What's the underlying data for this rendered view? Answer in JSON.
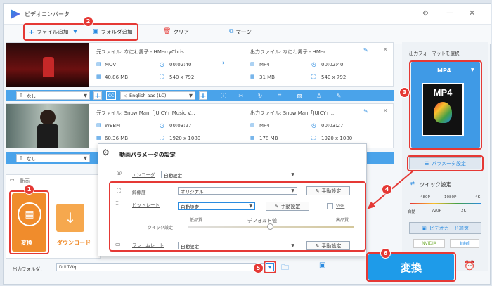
{
  "app": {
    "title": "ビデオコンバータ"
  },
  "toolbar": {
    "add_file": "ファイル追加",
    "add_folder": "フォルダ追加",
    "clear": "クリア",
    "merge": "マージ"
  },
  "files": [
    {
      "source": "元ファイル: なにわ男子 - HMerryChris...",
      "output": "出力ファイル: なにわ男子 - HMer...",
      "src_format": "MOV",
      "src_duration": "00:02:40",
      "src_size": "40.86 MB",
      "src_res": "540 x 792",
      "out_format": "MP4",
      "out_duration": "00:02:40",
      "out_size": "31 MB",
      "out_res": "540 x 792",
      "subtitle": "なし",
      "audio": "English aac (LC)"
    },
    {
      "source": "元ファイル: Snow Man「JUICY」Music V...",
      "output": "出力ファイル: Snow Man「JUICY」...",
      "src_format": "WEBM",
      "src_duration": "00:03:27",
      "src_size": "60.36 MB",
      "src_res": "1920 x 1080",
      "out_format": "MP4",
      "out_duration": "00:03:27",
      "out_size": "178 MB",
      "out_res": "1920 x 1080",
      "subtitle": "なし"
    }
  ],
  "left_panel": {
    "header": "動画",
    "convert": "変換",
    "download": "ダウンロード"
  },
  "dialog": {
    "title": "動画パラメータの設定",
    "encoder_label": "エンコーダ",
    "encoder_value": "自動設定",
    "resolution_label": "解像度",
    "resolution_value": "オリジナル",
    "bitrate_label": "ビットレート",
    "bitrate_value": "自動設定",
    "vbr": "VBR",
    "quick_label": "クイック設定",
    "low_q": "低品質",
    "default": "デフォルト値",
    "high_q": "高品質",
    "framerate_label": "フレームレート",
    "framerate_value": "自動設定",
    "manual": "手動設定"
  },
  "right_panel": {
    "header": "出力フォーマットを選択",
    "format": "MP4",
    "format_icon": "MP4",
    "param_button": "パラメータ設定",
    "quick_settings": "クイック設定",
    "q_top": [
      "480P",
      "1080P",
      "4K"
    ],
    "q_bottom": [
      "自動",
      "720P",
      "2K"
    ],
    "gpu_accel": "ビデオカード加速",
    "nvidia": "NVIDIA",
    "intel": "Intel"
  },
  "bottom": {
    "folder_label": "出力フォルダ：",
    "folder_path": "D:¥ffWq",
    "convert": "変換"
  },
  "badges": [
    "1",
    "2",
    "3",
    "4",
    "5",
    "6"
  ],
  "colors": {
    "accent": "#2a8be0",
    "highlight": "#e53935",
    "convert_btn": "#1e9be9",
    "orange": "#f08c2c"
  }
}
